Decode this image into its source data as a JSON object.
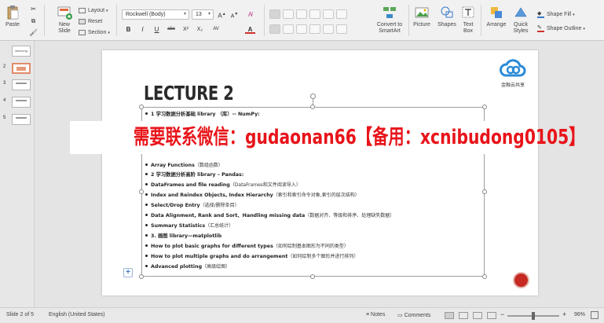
{
  "ribbon": {
    "paste_label": "Paste",
    "new_slide_label": "New\nSlide",
    "layout_label": "Layout",
    "reset_label": "Reset",
    "section_label": "Section",
    "font_name": "Rockwell (Body)",
    "font_size": "13",
    "convert_label": "Convert to\nSmartArt",
    "picture_label": "Picture",
    "shapes_label": "Shapes",
    "textbox_label": "Text\nBox",
    "arrange_label": "Arrange",
    "quick_styles_label": "Quick\nStyles",
    "shape_fill_label": "Shape Fill",
    "shape_outline_label": "Shape Outline",
    "bold": "B",
    "italic": "I",
    "underline": "U",
    "strike": "abc",
    "superscript": "X²",
    "subscript": "X₂",
    "spacing": "AV",
    "grow_font": "A",
    "shrink_font": "A",
    "text_color": "A",
    "accent_red": "#d0302a"
  },
  "thumbnails": {
    "numbers": [
      "1",
      "2",
      "3",
      "4",
      "5"
    ],
    "first_label": "welcomg"
  },
  "slide": {
    "title": "LECTURE 2",
    "logo_text": "金融云共享",
    "bullets": [
      {
        "bold": "1 学习数据分析基础 library （库）-- NumPy:",
        "cn": ""
      },
      {
        "bold": "Array Functions",
        "cn": "（数组函数）"
      },
      {
        "bold": "2 学习数据分析高阶 library – Pandas:",
        "cn": ""
      },
      {
        "bold": "DataFrames and file reading",
        "cn": "（DataFrames和文件阅读导入）"
      },
      {
        "bold": "Index and Reindex Objects, Index Hierarchy",
        "cn": "（索引和索引命令对象,索引的层次结构）"
      },
      {
        "bold": "Select/Drop Entry",
        "cn": "（选择/删除条目）"
      },
      {
        "bold": "Data Alignment, Rank and Sort、Handling missing data",
        "cn": "（数据对齐、等级和排序、处理缺失数据）"
      },
      {
        "bold": "Summary Statistics",
        "cn": "（汇总统计）"
      },
      {
        "bold": "3. 画图 library—matplotlib",
        "cn": ""
      },
      {
        "bold": "How to plot basic graphs for different types",
        "cn": "（如何绘制基本图形为不同的类型）"
      },
      {
        "bold": "How to plot multiple graphs and do arrangement",
        "cn": "（如何绘制多个图形并进行排列）"
      },
      {
        "bold": "Advanced plotting",
        "cn": "（高级绘图）"
      }
    ]
  },
  "watermark": {
    "text": "需要联系微信：gudaonan66【备用：xcnibudong0105】"
  },
  "status": {
    "slide_info": "Slide 2 of 5",
    "language": "English (United States)",
    "notes_label": "Notes",
    "comments_label": "Comments",
    "zoom": "96%"
  }
}
